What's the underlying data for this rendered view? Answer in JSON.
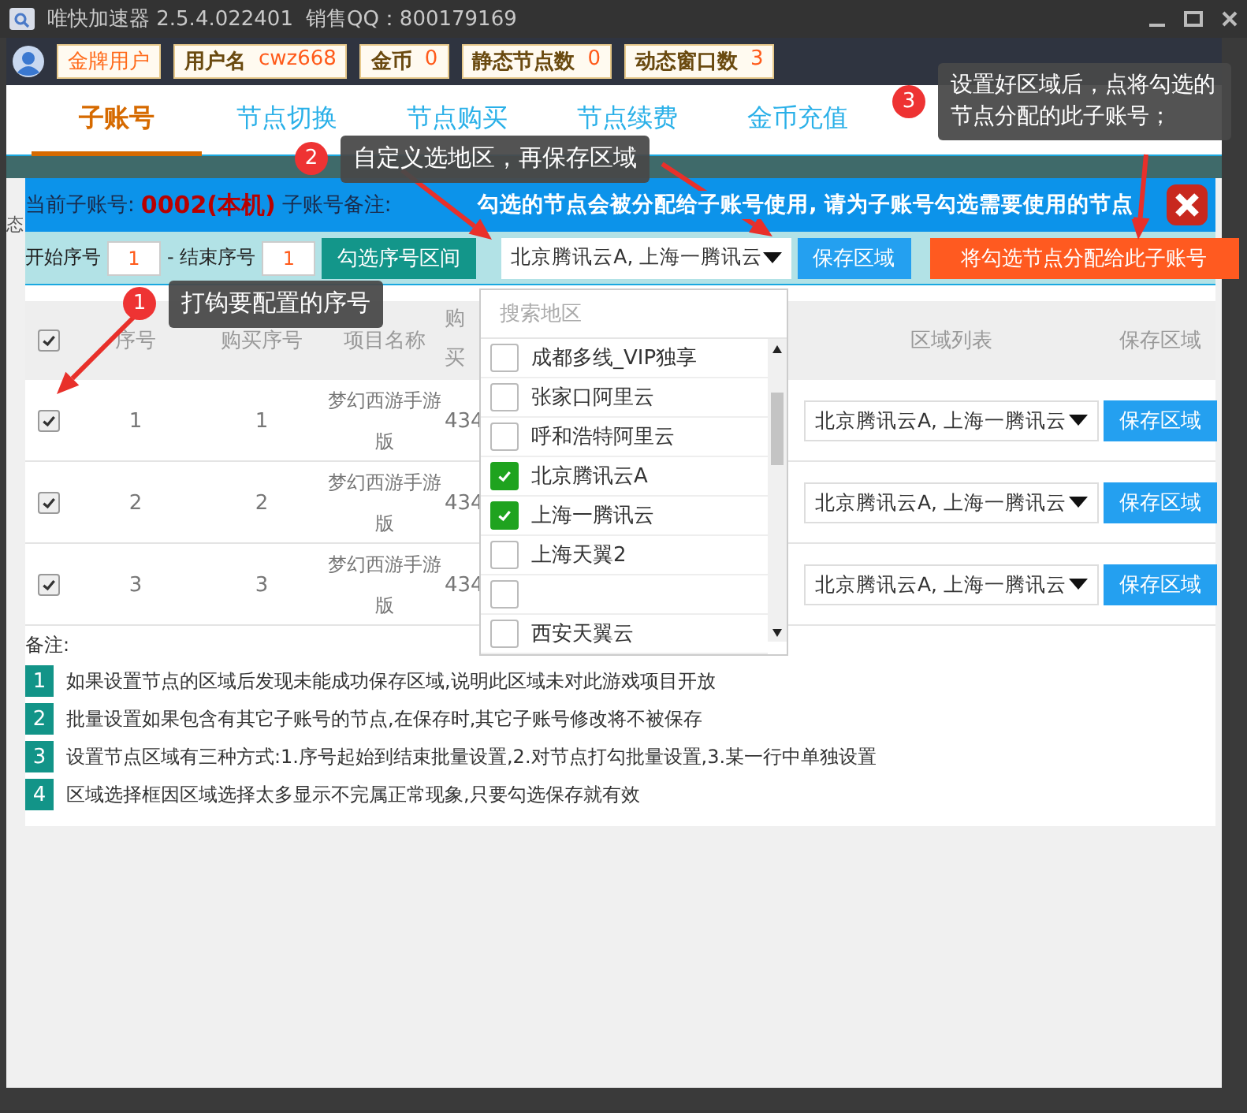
{
  "window": {
    "title": "唯快加速器 2.5.4.022401",
    "sales_qq": "销售QQ：800179169"
  },
  "user_bar": {
    "level": "金牌用户",
    "stats": [
      {
        "label": "用户名",
        "value": "cwz668"
      },
      {
        "label": "金币",
        "value": "0"
      },
      {
        "label": "静态节点数",
        "value": "0"
      },
      {
        "label": "动态窗口数",
        "value": "3"
      }
    ]
  },
  "tabs": [
    {
      "label": "子账号",
      "selected": true
    },
    {
      "label": "节点切换",
      "selected": false
    },
    {
      "label": "节点购买",
      "selected": false
    },
    {
      "label": "节点续费",
      "selected": false
    },
    {
      "label": "金币充值",
      "selected": false
    }
  ],
  "background_fragment": "态",
  "dialog": {
    "account_label": "当前子账号:",
    "account": "0002(本机)",
    "remark_label": "子账号备注:",
    "notice": "勾选的节点会被分配给子账号使用, 请为子账号勾选需要使用的节点",
    "toolbar": {
      "start_label": "开始序号",
      "start_value": "1",
      "end_label": "- 结束序号",
      "end_value": "1",
      "range_button": "勾选序号区间",
      "region_select": "北京腾讯云A, 上海一腾讯云",
      "save_button": "保存区域",
      "assign_button": "将勾选节点分配给此子账号"
    },
    "table": {
      "all_checked": true,
      "columns": [
        "序号",
        "购买序号",
        "项目名称",
        "购买",
        "区域列表",
        "保存区域"
      ],
      "rows": [
        {
          "checked": true,
          "index": "1",
          "purchase_index": "1",
          "project": "梦幻西游手游版",
          "column_4": "434",
          "region": "北京腾讯云A, 上海一腾讯云",
          "save_button": "保存区域"
        },
        {
          "checked": true,
          "index": "2",
          "purchase_index": "2",
          "project": "梦幻西游手游版",
          "column_4": "434",
          "region": "北京腾讯云A, 上海一腾讯云",
          "save_button": "保存区域"
        },
        {
          "checked": true,
          "index": "3",
          "purchase_index": "3",
          "project": "梦幻西游手游版",
          "column_4": "434",
          "region": "北京腾讯云A, 上海一腾讯云",
          "save_button": "保存区域"
        }
      ]
    },
    "notes_label": "备注:",
    "notes": [
      {
        "number": "1",
        "text": "如果设置节点的区域后发现未能成功保存区域,说明此区域未对此游戏项目开放"
      },
      {
        "number": "2",
        "text": "批量设置如果包含有其它子账号的节点,在保存时,其它子账号修改将不被保存"
      },
      {
        "number": "3",
        "text": "设置节点区域有三种方式:1.序号起始到结束批量设置,2.对节点打勾批量设置,3.某一行中单独设置"
      },
      {
        "number": "4",
        "text": "区域选择框因区域选择太多显示不完属正常现象,只要勾选保存就有效"
      }
    ]
  },
  "region_dropdown": {
    "placeholder": "搜索地区",
    "items": [
      {
        "label": "成都多线_VIP独享",
        "checked": false
      },
      {
        "label": "张家口阿里云",
        "checked": false
      },
      {
        "label": "呼和浩特阿里云",
        "checked": false
      },
      {
        "label": "北京腾讯云A",
        "checked": true
      },
      {
        "label": "上海一腾讯云",
        "checked": true
      },
      {
        "label": "上海天翼2",
        "checked": false
      },
      {
        "checked": false
      },
      {
        "label": "西安天翼云",
        "checked": false
      }
    ]
  },
  "tooltips": [
    {
      "number": "1",
      "text": "打钩要配置的序号"
    },
    {
      "number": "2",
      "text": "自定义选地区，再保存区域"
    },
    {
      "number": "3",
      "text": "设置好区域后，点将勾选的节点分配的此子账号；"
    }
  ]
}
